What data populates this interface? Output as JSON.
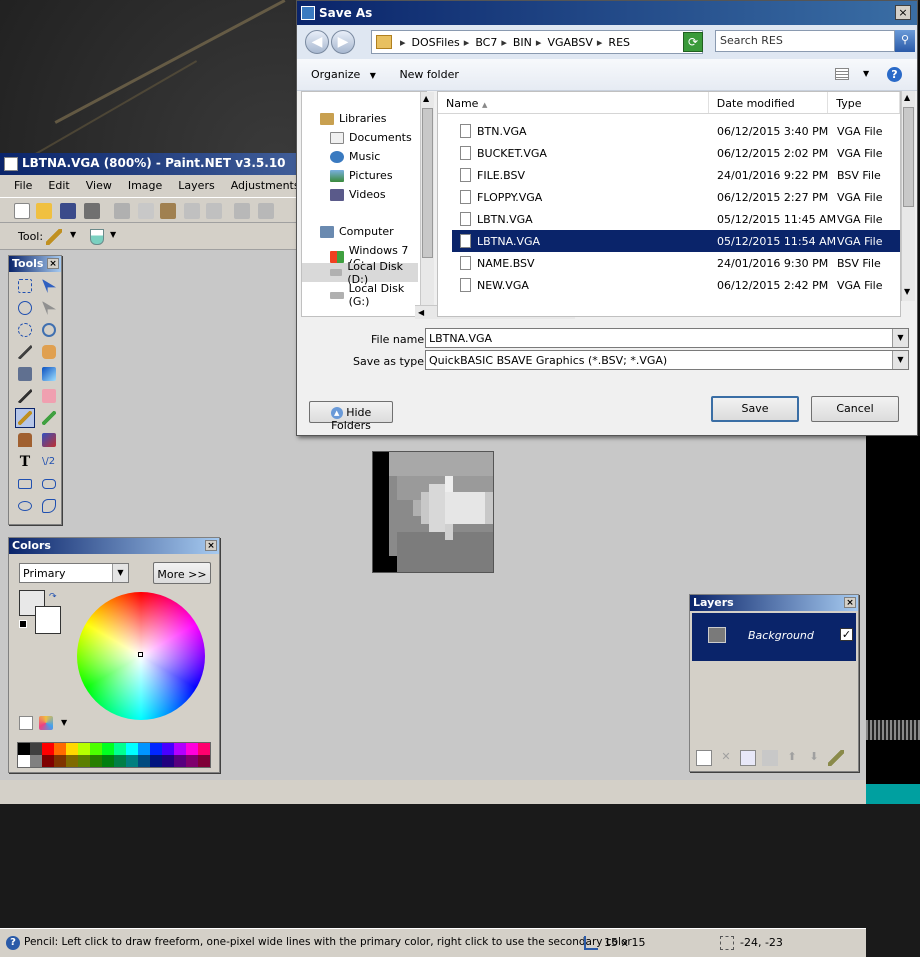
{
  "paintnet": {
    "title": "LBTNA.VGA (800%) - Paint.NET v3.5.10",
    "menu": [
      "File",
      "Edit",
      "View",
      "Image",
      "Layers",
      "Adjustments"
    ],
    "tool_label": "Tool:",
    "status_text": "Pencil: Left click to draw freeform, one-pixel wide lines with the primary color, right click to use the secondary color",
    "image_size": "15 x 15",
    "cursor_pos": "-24, -23"
  },
  "tools_panel": {
    "title": "Tools"
  },
  "colors_panel": {
    "title": "Colors",
    "mode": "Primary",
    "more_button": "More >>",
    "palette": [
      "#000000",
      "#404040",
      "#ff0000",
      "#ff6a00",
      "#ffd800",
      "#b6ff00",
      "#4cff00",
      "#00ff21",
      "#00ff90",
      "#00ffff",
      "#0094ff",
      "#0026ff",
      "#4800ff",
      "#b200ff",
      "#ff00dc",
      "#ff006e",
      "#ffffff",
      "#808080",
      "#7f0000",
      "#7f3300",
      "#7f6a00",
      "#5b7f00",
      "#267f00",
      "#007f0e",
      "#007f46",
      "#007f7f",
      "#004a7f",
      "#00137f",
      "#21007f",
      "#57007f",
      "#7f006e",
      "#7f0037"
    ]
  },
  "layers_panel": {
    "title": "Layers",
    "layer_name": "Background"
  },
  "save_dialog": {
    "title": "Save As",
    "path": [
      "DOSFiles",
      "BC7",
      "BIN",
      "VGABSV",
      "RES"
    ],
    "search_placeholder": "Search RES",
    "organize": "Organize",
    "new_folder": "New folder",
    "nav": [
      {
        "label": "Libraries",
        "indent": 0
      },
      {
        "label": "Documents",
        "indent": 1
      },
      {
        "label": "Music",
        "indent": 1
      },
      {
        "label": "Pictures",
        "indent": 1
      },
      {
        "label": "Videos",
        "indent": 1
      },
      {
        "label": "Computer",
        "indent": 0
      },
      {
        "label": "Windows 7 (C:",
        "indent": 1
      },
      {
        "label": "Local Disk (D:)",
        "indent": 1
      },
      {
        "label": "Local Disk (G:)",
        "indent": 1
      }
    ],
    "columns": {
      "name": "Name",
      "date": "Date modified",
      "type": "Type"
    },
    "files": [
      {
        "name": "BTN.VGA",
        "date": "06/12/2015 3:40 PM",
        "type": "VGA File"
      },
      {
        "name": "BUCKET.VGA",
        "date": "06/12/2015 2:02 PM",
        "type": "VGA File"
      },
      {
        "name": "FILE.BSV",
        "date": "24/01/2016 9:22 PM",
        "type": "BSV File"
      },
      {
        "name": "FLOPPY.VGA",
        "date": "06/12/2015 2:27 PM",
        "type": "VGA File"
      },
      {
        "name": "LBTN.VGA",
        "date": "05/12/2015 11:45 AM",
        "type": "VGA File"
      },
      {
        "name": "LBTNA.VGA",
        "date": "05/12/2015 11:54 AM",
        "type": "VGA File"
      },
      {
        "name": "NAME.BSV",
        "date": "24/01/2016 9:30 PM",
        "type": "BSV File"
      },
      {
        "name": "NEW.VGA",
        "date": "06/12/2015 2:42 PM",
        "type": "VGA File"
      }
    ],
    "filename_label": "File name:",
    "filename_value": "LBTNA.VGA",
    "type_label": "Save as type:",
    "type_value": "QuickBASIC BSAVE Graphics (*.BSV; *.VGA)",
    "hide_folders": "Hide Folders",
    "save": "Save",
    "cancel": "Cancel"
  }
}
